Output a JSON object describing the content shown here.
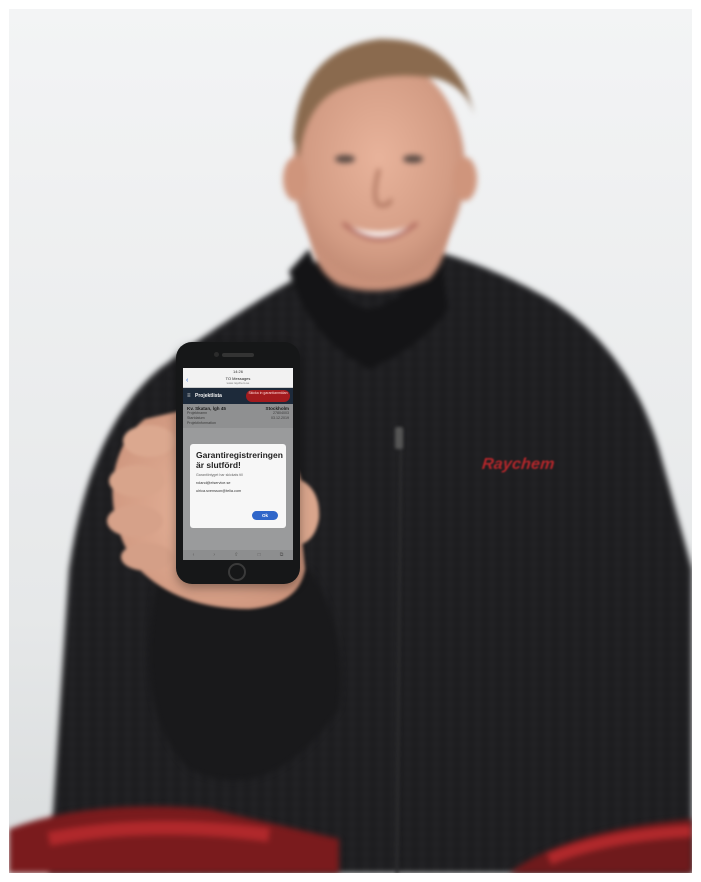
{
  "phone": {
    "status_time": "14:26",
    "browser": {
      "back": "‹",
      "title": "TO Messages",
      "subtitle": "www.raychem.se"
    },
    "header": {
      "menu": "≡",
      "title": "Projektlista",
      "warranty_button": "Skicka in garantianmälan"
    },
    "project": {
      "address": "Kv. Skatan, lgh 45",
      "city": "Stockholm",
      "rows": [
        {
          "label": "Projektnamn",
          "value": "27804003"
        },
        {
          "label": "Startdatum",
          "value": "03.12.2019"
        },
        {
          "label": "Projektinformation",
          "value": ""
        }
      ]
    },
    "dialog": {
      "title": "Garantiregistreringen är slutförd!",
      "message": "Garantiintyget har skickats till",
      "emails": [
        "roland@elservice.se",
        "ulrica.svensson@telia.com"
      ],
      "ok_label": "Ok"
    },
    "tabbar": [
      "‹",
      "›",
      "⇧",
      "□",
      "⧉"
    ]
  },
  "jacket": {
    "brand_text": "Raychem",
    "brand_color": "#b3262a"
  },
  "colors": {
    "jacket": "#1a1a1c",
    "background": "#e9ebec",
    "accent_red": "#c0282c"
  }
}
